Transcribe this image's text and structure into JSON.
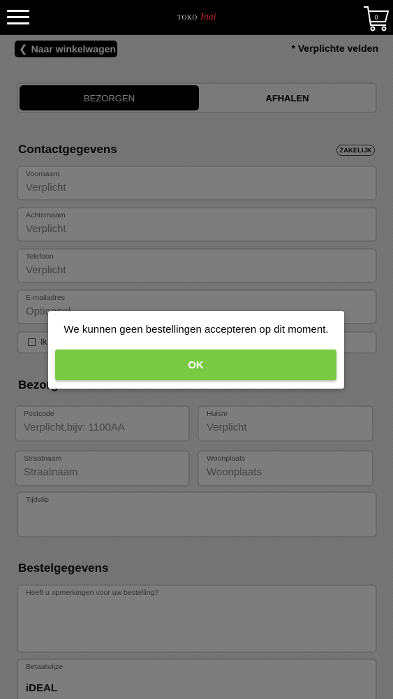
{
  "header": {
    "logo_text": "TOKO",
    "logo_script": "Inai",
    "cart_count": "0"
  },
  "nav": {
    "back_label": "Naar winkelwagen",
    "required_note": "* Verplichte velden"
  },
  "delivery_toggle": {
    "options": [
      "BEZORGEN",
      "AFHALEN"
    ],
    "active": "BEZORGEN"
  },
  "contact": {
    "title": "Contactgegevens",
    "business_label": "ZAKELIJK",
    "fields": [
      {
        "label": "Voornaam",
        "placeholder": "Verplicht"
      },
      {
        "label": "Achternaam",
        "placeholder": "Verplicht"
      },
      {
        "label": "Telefoon",
        "placeholder": "Verplicht"
      },
      {
        "label": "E-mailadres",
        "placeholder": "Optioneel"
      }
    ],
    "checkbox_label": "Ik"
  },
  "delivery": {
    "title": "Bezorg",
    "fields": [
      {
        "label": "Postcode",
        "placeholder": "Verplicht,bijv: 1100AA"
      },
      {
        "label": "Huisnr",
        "placeholder": "Verplicht"
      },
      {
        "label": "Straatnaam",
        "placeholder": "Straatnaam"
      },
      {
        "label": "Woonplaats",
        "placeholder": "Woonplaats"
      },
      {
        "label": "Tijdstip",
        "placeholder": ""
      }
    ]
  },
  "order": {
    "title": "Bestelgegevens",
    "remarks_label": "Heeft u opmerkingen voor uw bestelling?",
    "payment_label": "Betaalwijze",
    "payment_value": "iDEAL"
  },
  "dialog": {
    "message": "We kunnen geen bestellingen accepteren op dit moment.",
    "ok_label": "OK"
  },
  "colors": {
    "ok_button": "#7ac943",
    "header_bg": "#000000",
    "logo_accent": "#c8282e"
  }
}
